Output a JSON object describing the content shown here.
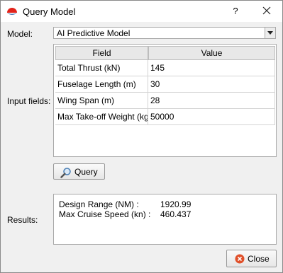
{
  "window": {
    "title": "Query Model",
    "help_label": "?",
    "icons": {
      "app": "app-logo-icon",
      "close": "close-icon"
    }
  },
  "model": {
    "label": "Model:",
    "selected": "AI Predictive Model"
  },
  "input": {
    "label": "Input fields:",
    "columns": [
      "Field",
      "Value"
    ],
    "rows": [
      [
        "Total Thrust (kN)",
        "145"
      ],
      [
        "Fuselage Length (m)",
        "30"
      ],
      [
        "Wing Span (m)",
        "28"
      ],
      [
        "Max Take-off Weight (kg)",
        "50000"
      ]
    ]
  },
  "query_button": {
    "label": "Query",
    "icon": "magnifier-icon"
  },
  "results": {
    "label": "Results:",
    "items": [
      {
        "name": "Design Range (NM) :",
        "value": "1920.99"
      },
      {
        "name": "Max Cruise Speed (kn) :",
        "value": "460.437"
      }
    ]
  },
  "close_button": {
    "label": "Close",
    "icon": "close-circle-icon"
  },
  "colors": {
    "dialog_bg": "#f0f0f0",
    "titlebar_bg": "#ffffff",
    "close_icon": "#e0502a"
  }
}
